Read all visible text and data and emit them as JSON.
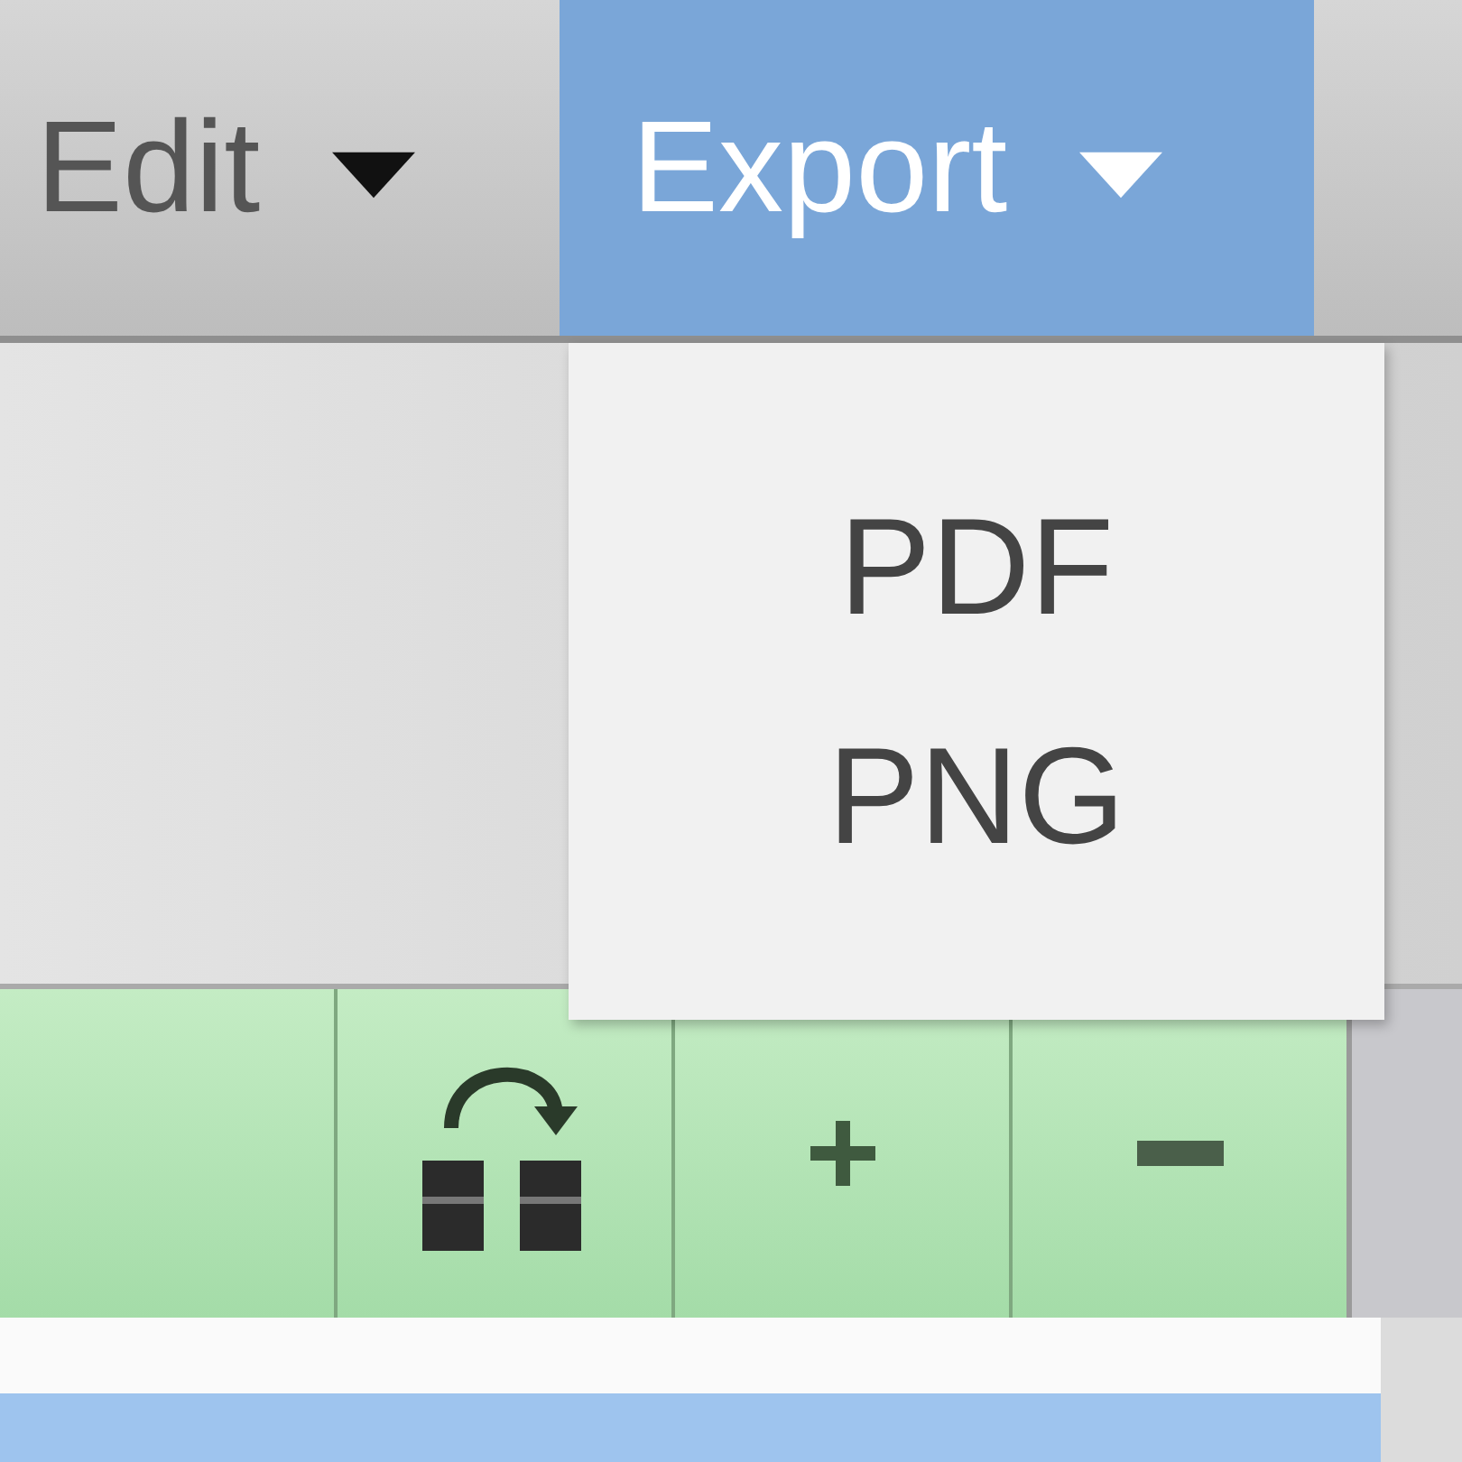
{
  "menu_bar": [
    {
      "label": "Edit",
      "open": false
    },
    {
      "label": "Export",
      "open": true
    }
  ],
  "dropdown": {
    "items": [
      {
        "label": "PDF"
      },
      {
        "label": "PNG"
      }
    ]
  }
}
